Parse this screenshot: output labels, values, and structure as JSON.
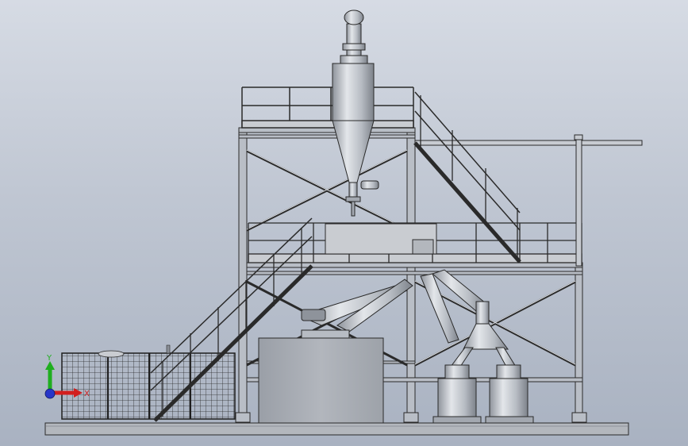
{
  "viewport": {
    "background_top": "#d6dbe4",
    "background_bottom": "#a9b2c1"
  },
  "triad": {
    "y_label": "Y",
    "x_label": "X",
    "y_color": "#1fae1f",
    "x_color": "#d21f1f",
    "z_color": "#2836c8"
  },
  "colors": {
    "steel_line": "#2a2a2a",
    "steel_fill": "#b9bec6",
    "equipment_fill": "#a3a8b0",
    "equipment_light": "#d4d7dc",
    "base_fill": "#b3b7bd"
  }
}
